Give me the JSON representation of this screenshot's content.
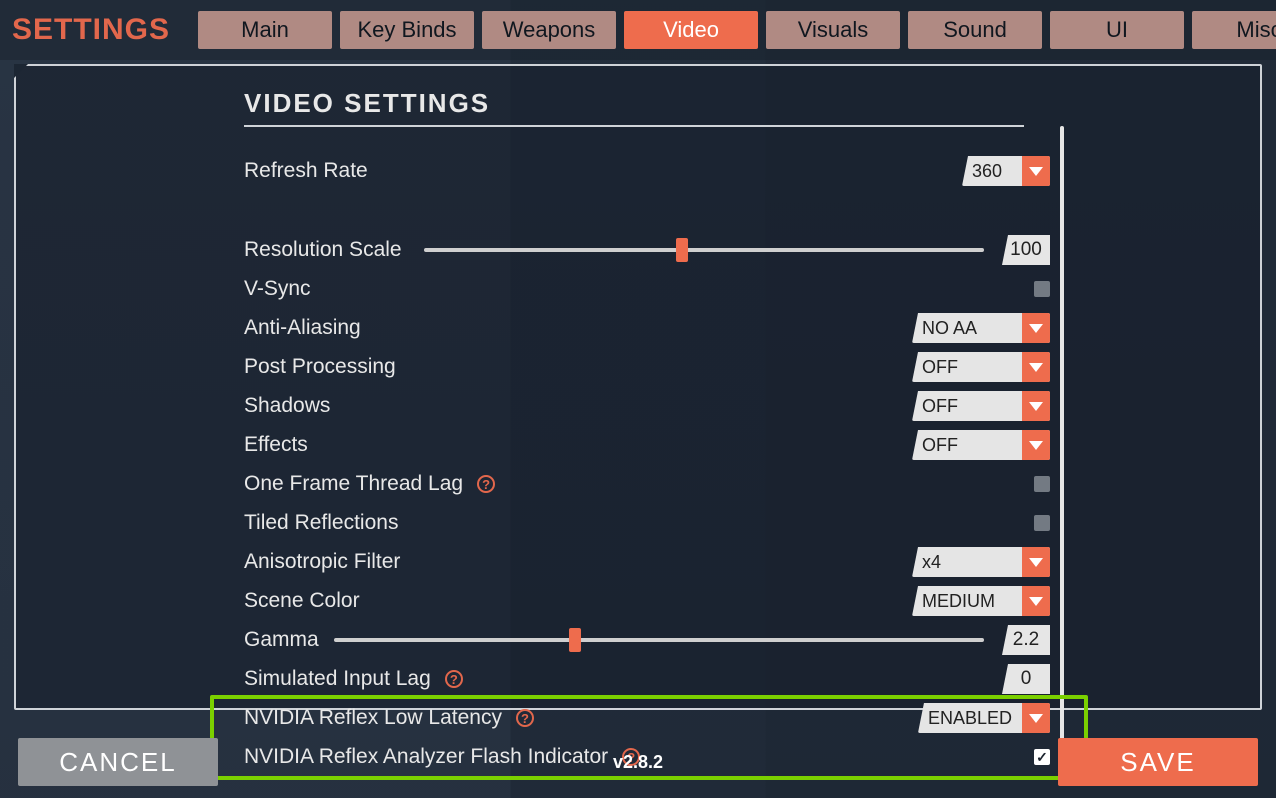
{
  "title": "SETTINGS",
  "tabs": [
    {
      "label": "Main",
      "active": false
    },
    {
      "label": "Key Binds",
      "active": false
    },
    {
      "label": "Weapons",
      "active": false
    },
    {
      "label": "Video",
      "active": true
    },
    {
      "label": "Visuals",
      "active": false
    },
    {
      "label": "Sound",
      "active": false
    },
    {
      "label": "UI",
      "active": false
    },
    {
      "label": "Misc",
      "active": false
    }
  ],
  "section": {
    "title": "VIDEO SETTINGS"
  },
  "settings": {
    "refresh_rate": {
      "label": "Refresh Rate",
      "value": "360"
    },
    "resolution_scale": {
      "label": "Resolution Scale",
      "value": "100",
      "pos_pct": 46
    },
    "vsync": {
      "label": "V-Sync",
      "checked": false
    },
    "anti_aliasing": {
      "label": "Anti-Aliasing",
      "value": "NO AA"
    },
    "post_processing": {
      "label": "Post Processing",
      "value": "OFF"
    },
    "shadows": {
      "label": "Shadows",
      "value": "OFF"
    },
    "effects": {
      "label": "Effects",
      "value": "OFF"
    },
    "one_frame_thread_lag": {
      "label": "One Frame Thread Lag",
      "checked": false
    },
    "tiled_reflections": {
      "label": "Tiled Reflections",
      "checked": false
    },
    "anisotropic_filter": {
      "label": "Anisotropic Filter",
      "value": "x4"
    },
    "scene_color": {
      "label": "Scene Color",
      "value": "MEDIUM"
    },
    "gamma": {
      "label": "Gamma",
      "value": "2.2",
      "pos_pct": 37
    },
    "simulated_input_lag": {
      "label": "Simulated Input Lag",
      "value": "0"
    },
    "reflex": {
      "label": "NVIDIA Reflex Low Latency",
      "value": "ENABLED"
    },
    "reflex_flash": {
      "label": "NVIDIA Reflex Analyzer Flash Indicator",
      "checked": true
    }
  },
  "footer": {
    "cancel": "CANCEL",
    "save": "SAVE",
    "version": "v2.8.2"
  }
}
